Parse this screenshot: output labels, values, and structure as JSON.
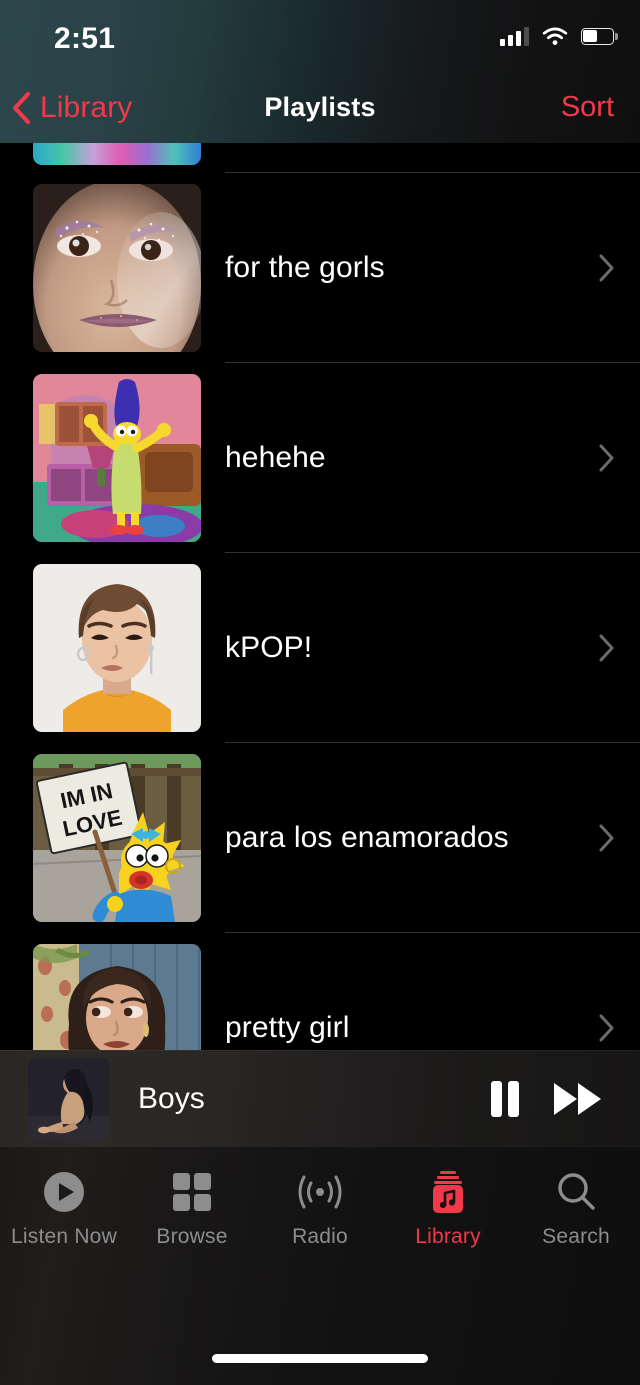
{
  "status_bar": {
    "time": "2:51",
    "cellular_icon": "cellular-bars-icon",
    "cellular_bars_filled": 3,
    "cellular_bars_total": 4,
    "wifi_icon": "wifi-icon",
    "battery_icon": "battery-icon",
    "battery_level_percent": 55
  },
  "nav_bar": {
    "back_icon": "chevron-left-icon",
    "back_label": "Library",
    "title": "Playlists",
    "sort_label": "Sort",
    "accent_color": "#f0394a"
  },
  "playlists": [
    {
      "title": "for the gorls",
      "artwork_name": "glitter-makeup-face-artwork",
      "disclosure_icon": "chevron-right-icon"
    },
    {
      "title": "hehehe",
      "artwork_name": "marge-simpson-dancing-artwork",
      "disclosure_icon": "chevron-right-icon"
    },
    {
      "title": "kPOP!",
      "artwork_name": "kpop-idol-yellow-shirt-artwork",
      "disclosure_icon": "chevron-right-icon"
    },
    {
      "title": "para los enamorados",
      "artwork_name": "maggie-simpson-im-in-love-sign-artwork",
      "disclosure_icon": "chevron-right-icon"
    },
    {
      "title": "pretty girl",
      "artwork_name": "woman-red-blouse-yes-artwork",
      "disclosure_icon": "chevron-right-icon"
    }
  ],
  "now_playing": {
    "track_title": "Boys",
    "artwork_name": "seated-figure-dark-artwork",
    "pause_icon": "pause-icon",
    "forward_icon": "fast-forward-icon"
  },
  "tab_bar": {
    "active_tab": "Library",
    "items": [
      {
        "label": "Listen Now",
        "icon": "play-circle-icon"
      },
      {
        "label": "Browse",
        "icon": "grid-squares-icon"
      },
      {
        "label": "Radio",
        "icon": "radio-waves-icon"
      },
      {
        "label": "Library",
        "icon": "library-music-icon"
      },
      {
        "label": "Search",
        "icon": "magnifying-glass-icon"
      }
    ]
  }
}
